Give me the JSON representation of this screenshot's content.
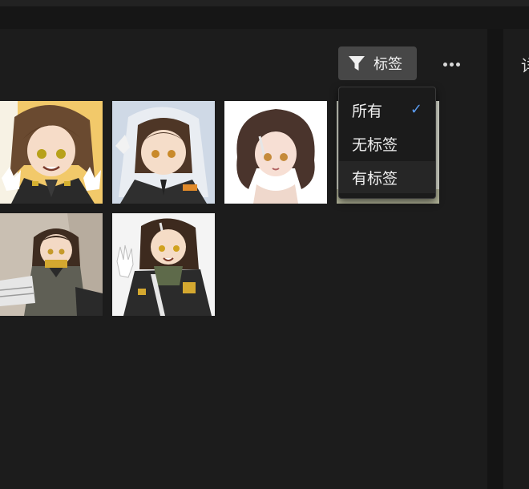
{
  "toolbar": {
    "filter_label": "标签",
    "filter_icon": "funnel-icon",
    "more_icon": "more-horizontal-icon"
  },
  "right_panel": {
    "title": "详"
  },
  "gallery": {
    "images": [
      {
        "name": "image-1",
        "background": "#f2c96a"
      },
      {
        "name": "image-2",
        "background": "#cfd9e6"
      },
      {
        "name": "image-3",
        "background": "#ffffff"
      },
      {
        "name": "image-4",
        "background": "#dfe2d5"
      },
      {
        "name": "image-5",
        "background": "#c9bfb2"
      },
      {
        "name": "image-6",
        "background": "#f4f4f4"
      }
    ]
  },
  "filter_menu": {
    "items": [
      {
        "label": "所有",
        "selected": true
      },
      {
        "label": "无标签",
        "selected": false
      },
      {
        "label": "有标签",
        "selected": false
      }
    ],
    "check_glyph": "✓"
  },
  "colors": {
    "background": "#1c1c1c",
    "button": "#474747",
    "accent_check": "#5b9cf0"
  }
}
